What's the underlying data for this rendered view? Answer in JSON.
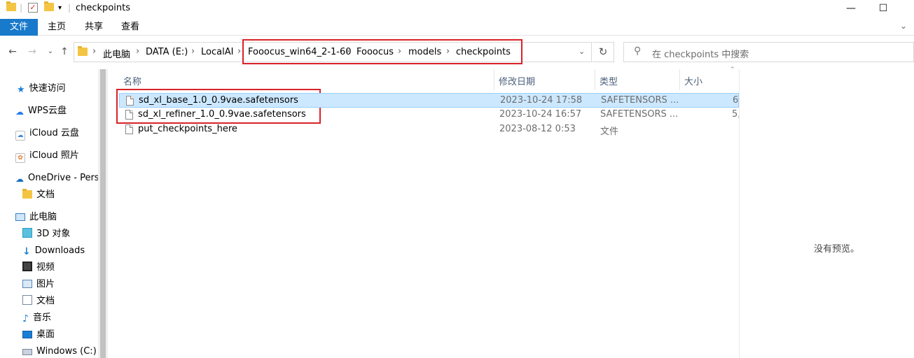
{
  "window": {
    "title": "checkpoints",
    "controls": {
      "minimize": "—",
      "maximize": "☐",
      "close": "✕"
    }
  },
  "ribbon": {
    "tabs": [
      "文件",
      "主页",
      "共享",
      "查看"
    ]
  },
  "address_bar": {
    "root": "此电脑",
    "crumbs": [
      "此电脑",
      "DATA (E:)",
      "LocalAI",
      "Fooocus_win64_2-1-60",
      "Fooocus",
      "models",
      "checkpoints"
    ]
  },
  "search": {
    "placeholder": "在 checkpoints 中搜索"
  },
  "nav_pane": {
    "items": [
      {
        "label": "快速访问",
        "icon": "star-icon"
      },
      {
        "label": "WPS云盘",
        "icon": "cloud-icon"
      },
      {
        "label": "iCloud 云盘",
        "icon": "icloud-icon"
      },
      {
        "label": "iCloud 照片",
        "icon": "photos-icon"
      },
      {
        "label": "OneDrive - Personal",
        "icon": "onedrive-icon"
      },
      {
        "label": "文档",
        "icon": "folder-icon"
      },
      {
        "label": "此电脑",
        "icon": "computer-icon"
      },
      {
        "label": "3D 对象",
        "icon": "cube-icon"
      },
      {
        "label": "Downloads",
        "icon": "download-icon"
      },
      {
        "label": "视频",
        "icon": "video-icon"
      },
      {
        "label": "图片",
        "icon": "picture-icon"
      },
      {
        "label": "文档",
        "icon": "document-icon"
      },
      {
        "label": "音乐",
        "icon": "music-icon"
      },
      {
        "label": "桌面",
        "icon": "desktop-icon"
      },
      {
        "label": "Windows (C:)",
        "icon": "drive-icon"
      }
    ]
  },
  "file_list": {
    "columns": [
      "名称",
      "修改日期",
      "类型",
      "大小"
    ],
    "rows": [
      {
        "name": "sd_xl_base_1.0_0.9vae.safetensors",
        "date": "2023-10-24 17:58",
        "type": "SAFETENSORS ...",
        "size": "6",
        "selected": true
      },
      {
        "name": "sd_xl_refiner_1.0_0.9vae.safetensors",
        "date": "2023-10-24 16:57",
        "type": "SAFETENSORS ...",
        "size": "5,",
        "selected": false
      },
      {
        "name": "put_checkpoints_here",
        "date": "2023-08-12 0:53",
        "type": "文件",
        "size": "",
        "selected": false
      }
    ]
  },
  "preview_pane": {
    "message": "没有预览。"
  },
  "colors": {
    "accent": "#1979ca",
    "selection": "#cce8ff",
    "highlight_box": "#d9222a"
  }
}
